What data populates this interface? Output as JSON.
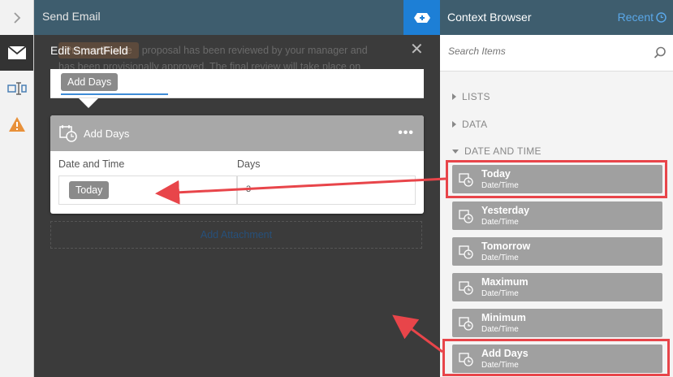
{
  "main": {
    "title": "Send Email"
  },
  "background": {
    "token": "ProposalName",
    "text_line1": "proposal has been reviewed by your manager and",
    "text_line2": "has been provisionally approved. The final review will take place on",
    "attachment_label": "Add Attachment"
  },
  "modal": {
    "title": "Edit SmartField",
    "expression_pill": "Add Days",
    "card_title": "Add Days",
    "field_date_label": "Date and Time",
    "field_date_value": "Today",
    "field_days_label": "Days",
    "field_days_value": "3"
  },
  "context_browser": {
    "title": "Context Browser",
    "recent_label": "Recent",
    "search_placeholder": "Search Items",
    "sections": [
      "LISTS",
      "DATA",
      "DATE AND TIME"
    ],
    "items": [
      {
        "name": "Today",
        "type": "Date/Time"
      },
      {
        "name": "Yesterday",
        "type": "Date/Time"
      },
      {
        "name": "Tomorrow",
        "type": "Date/Time"
      },
      {
        "name": "Maximum",
        "type": "Date/Time"
      },
      {
        "name": "Minimum",
        "type": "Date/Time"
      },
      {
        "name": "Add Days",
        "type": "Date/Time"
      }
    ]
  },
  "colors": {
    "header": "#3e5d6e",
    "accent": "#1d7fd6",
    "annotation": "#e8454a",
    "item_bg": "#a0a0a0"
  }
}
